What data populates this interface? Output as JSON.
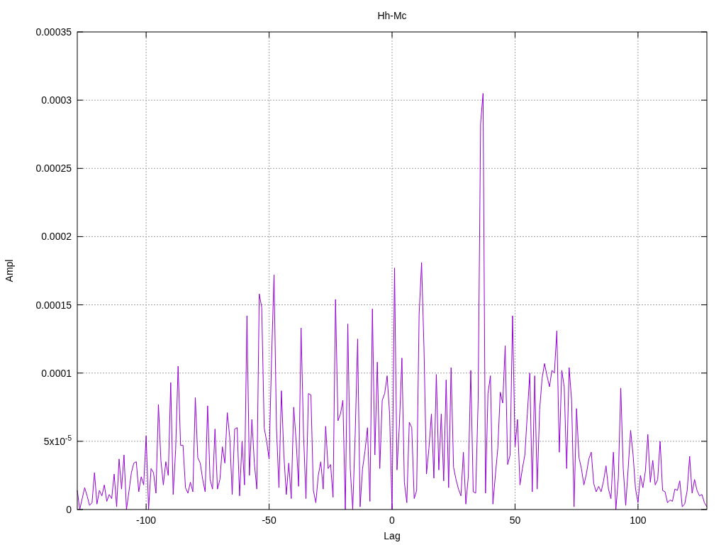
{
  "chart_data": {
    "type": "line",
    "title": "Hh-Mc",
    "xlabel": "Lag",
    "ylabel": "Ampl",
    "grid": true,
    "xlim": [
      -128,
      128
    ],
    "ylim": [
      0,
      0.00035
    ],
    "xticks": [
      -100,
      -50,
      0,
      50,
      100
    ],
    "yticks": [
      {
        "value": 0,
        "label": "0"
      },
      {
        "value": 5e-05,
        "label": "5x10$^{-5}$"
      },
      {
        "value": 0.0001,
        "label": "0.0001"
      },
      {
        "value": 0.00015,
        "label": "0.00015"
      },
      {
        "value": 0.0002,
        "label": "0.0002"
      },
      {
        "value": 0.00025,
        "label": "0.00025"
      },
      {
        "value": 0.0003,
        "label": "0.0003"
      },
      {
        "value": 0.00035,
        "label": "0.00035"
      }
    ],
    "x": [
      -128,
      -127,
      -126,
      -125,
      -124,
      -123,
      -122,
      -121,
      -120,
      -119,
      -118,
      -117,
      -116,
      -115,
      -114,
      -113,
      -112,
      -111,
      -110,
      -109,
      -108,
      -107,
      -106,
      -105,
      -104,
      -103,
      -102,
      -101,
      -100,
      -99,
      -98,
      -97,
      -96,
      -95,
      -94,
      -93,
      -92,
      -91,
      -90,
      -89,
      -88,
      -87,
      -86,
      -85,
      -84,
      -83,
      -82,
      -81,
      -80,
      -79,
      -78,
      -77,
      -76,
      -75,
      -74,
      -73,
      -72,
      -71,
      -70,
      -69,
      -68,
      -67,
      -66,
      -65,
      -64,
      -63,
      -62,
      -61,
      -60,
      -59,
      -58,
      -57,
      -56,
      -55,
      -54,
      -53,
      -52,
      -51,
      -50,
      -49,
      -48,
      -47,
      -46,
      -45,
      -44,
      -43,
      -42,
      -41,
      -40,
      -39,
      -38,
      -37,
      -36,
      -35,
      -34,
      -33,
      -32,
      -31,
      -30,
      -29,
      -28,
      -27,
      -26,
      -25,
      -24,
      -23,
      -22,
      -21,
      -20,
      -19,
      -18,
      -17,
      -16,
      -15,
      -14,
      -13,
      -12,
      -11,
      -10,
      -9,
      -8,
      -7,
      -6,
      -5,
      -4,
      -3,
      -2,
      -1,
      0,
      1,
      2,
      3,
      4,
      5,
      6,
      7,
      8,
      9,
      10,
      11,
      12,
      13,
      14,
      15,
      16,
      17,
      18,
      19,
      20,
      21,
      22,
      23,
      24,
      25,
      26,
      27,
      28,
      29,
      30,
      31,
      32,
      33,
      34,
      35,
      36,
      37,
      38,
      39,
      40,
      41,
      42,
      43,
      44,
      45,
      46,
      47,
      48,
      49,
      50,
      51,
      52,
      53,
      54,
      55,
      56,
      57,
      58,
      59,
      60,
      61,
      62,
      63,
      64,
      65,
      66,
      67,
      68,
      69,
      70,
      71,
      72,
      73,
      74,
      75,
      76,
      77,
      78,
      79,
      80,
      81,
      82,
      83,
      84,
      85,
      86,
      87,
      88,
      89,
      90,
      91,
      92,
      93,
      94,
      95,
      96,
      97,
      98,
      99,
      100,
      101,
      102,
      103,
      104,
      105,
      106,
      107,
      108,
      109,
      110,
      111,
      112,
      113,
      114,
      115,
      116,
      117,
      118,
      119,
      120,
      121,
      122,
      123,
      124,
      125,
      126,
      127,
      128
    ],
    "series": [
      {
        "color": "#9400d3",
        "values": [
          1.4e-05,
          0,
          8e-06,
          1.6e-05,
          1e-05,
          3e-06,
          5e-06,
          2.7e-05,
          4e-06,
          1.4e-05,
          1e-05,
          1.8e-05,
          6e-06,
          1.1e-05,
          8e-06,
          2.6e-05,
          2e-06,
          3.7e-05,
          1.5e-05,
          4e-05,
          0,
          1.3e-05,
          2.7e-05,
          3.4e-05,
          3.5e-05,
          1.3e-05,
          2.4e-05,
          1.8e-05,
          5.4e-05,
          0,
          3e-05,
          2.7e-05,
          1.2e-05,
          7.7e-05,
          3.6e-05,
          1.8e-05,
          3.5e-05,
          2.5e-05,
          9.3e-05,
          1.1e-05,
          4.4e-05,
          0.000105,
          4.7e-05,
          4.7e-05,
          1.6e-05,
          1.2e-05,
          2e-05,
          1.3e-05,
          8.2e-05,
          3.8e-05,
          3.4e-05,
          2.2e-05,
          1.3e-05,
          7.6e-05,
          2.2e-05,
          1.5e-05,
          5.9e-05,
          1.5e-05,
          2.2e-05,
          4.6e-05,
          3.4e-05,
          7.1e-05,
          5.3e-05,
          1.1e-05,
          5.9e-05,
          6e-05,
          1e-05,
          5e-05,
          1.8e-05,
          0.000142,
          2.5e-05,
          6.6e-05,
          3.4e-05,
          1.5e-05,
          0.000158,
          0.000148,
          6e-05,
          5e-05,
          3.7e-05,
          0.00011,
          0.000172,
          6e-05,
          1.6e-05,
          8.7e-05,
          4e-05,
          1.1e-05,
          3.4e-05,
          8e-06,
          7.5e-05,
          5e-05,
          1.7e-05,
          0.000133,
          5.5e-05,
          8e-06,
          8.5e-05,
          8.4e-05,
          1.4e-05,
          5e-06,
          2.5e-05,
          3.5e-05,
          1.5e-05,
          6.1e-05,
          3e-05,
          3.3e-05,
          9e-06,
          0.000154,
          6.5e-05,
          7e-05,
          8e-05,
          0,
          0.000136,
          3e-05,
          0,
          5.5e-05,
          0.000125,
          2e-06,
          3e-05,
          4.3e-05,
          6e-05,
          6e-06,
          0.000147,
          4e-05,
          0.000108,
          3e-05,
          8e-05,
          8.5e-05,
          9.8e-05,
          7e-05,
          0,
          0.000177,
          2.9e-05,
          6.3e-05,
          0.000111,
          2e-05,
          5e-06,
          6.4e-05,
          6e-05,
          8e-06,
          1.4e-05,
          0.000143,
          0.000181,
          0.000117,
          2.6e-05,
          4.5e-05,
          7e-05,
          2.3e-05,
          9.9e-05,
          2.9e-05,
          7e-05,
          2.1e-05,
          9.5e-05,
          1.6e-05,
          0.000104,
          3.1e-05,
          2.2e-05,
          1.5e-05,
          1e-05,
          4.2e-05,
          4e-06,
          2.4e-05,
          0.000102,
          1.3e-05,
          1.2e-05,
          8e-05,
          0.000283,
          0.000305,
          1.2e-05,
          8.5e-05,
          9.8e-05,
          4e-06,
          2.5e-05,
          4.5e-05,
          8.6e-05,
          7.8e-05,
          0.00012,
          3.3e-05,
          4e-05,
          0.000142,
          4.6e-05,
          6.6e-05,
          1.8e-05,
          3e-05,
          4e-05,
          7e-05,
          0.0001,
          1.3e-05,
          9.8e-05,
          1.5e-05,
          7.3e-05,
          9.6e-05,
          0.000107,
          9.8e-05,
          9e-05,
          0.000102,
          0.0001,
          0.000131,
          4.2e-05,
          0.000102,
          9e-05,
          3e-05,
          0.000104,
          8e-05,
          2e-06,
          7.4e-05,
          3.8e-05,
          3e-05,
          1.8e-05,
          2.6e-05,
          3.7e-05,
          4.2e-05,
          1.9e-05,
          1.3e-05,
          1.7e-05,
          1.3e-05,
          2.1e-05,
          3.2e-05,
          1.5e-05,
          8e-06,
          4.2e-05,
          0,
          2.3e-05,
          8.9e-05,
          3e-05,
          3e-06,
          3e-05,
          5.8e-05,
          4e-05,
          1.5e-05,
          5e-06,
          2.5e-05,
          1.6e-05,
          2.8e-05,
          5.5e-05,
          2e-05,
          3.6e-05,
          1.8e-05,
          2.2e-05,
          5e-05,
          1.4e-05,
          1.3e-05,
          5e-06,
          7e-06,
          6e-06,
          1.5e-05,
          1.4e-05,
          2.1e-05,
          2e-06,
          4e-06,
          1.4e-05,
          3.9e-05,
          1.2e-05,
          2.2e-05,
          1.4e-05,
          1e-05,
          1.1e-05,
          5e-06,
          2e-06
        ]
      }
    ]
  }
}
